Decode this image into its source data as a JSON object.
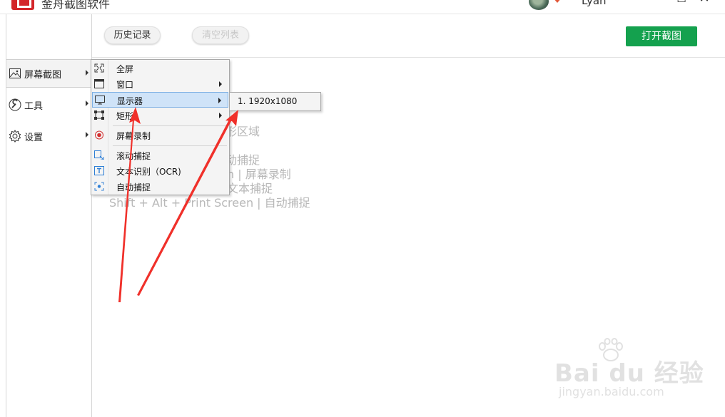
{
  "window": {
    "title": "金舟截图软件",
    "username": "Lyan",
    "minimize_glyph": "—",
    "maximize_glyph": "☐",
    "close_glyph": "✕"
  },
  "toolbar": {
    "history_label": "历史记录",
    "clear_label": "清空列表",
    "open_label": "打开截图"
  },
  "sidebar": {
    "items": [
      {
        "label": "屏幕截图",
        "icon": "image-icon",
        "active": true
      },
      {
        "label": "工具",
        "icon": "wrench-icon",
        "active": false
      },
      {
        "label": "设置",
        "icon": "gear-icon",
        "active": false
      }
    ]
  },
  "menu": {
    "items": [
      {
        "label": "全屏",
        "icon": "fullscreen-icon",
        "submenu": false
      },
      {
        "label": "窗口",
        "icon": "window-icon",
        "submenu": true
      },
      {
        "label": "显示器",
        "icon": "monitor-icon",
        "submenu": true,
        "highlighted": true
      },
      {
        "label": "矩形",
        "icon": "rectangle-icon",
        "submenu": true
      },
      {
        "label": "屏幕录制",
        "icon": "record-icon",
        "submenu": false
      },
      {
        "label": "滚动捕捉",
        "icon": "scroll-capture-icon",
        "submenu": false
      },
      {
        "label": "文本识别（OCR)",
        "icon": "ocr-text-icon",
        "submenu": false
      },
      {
        "label": "自动捕捉",
        "icon": "auto-capture-icon",
        "submenu": false
      }
    ]
  },
  "submenu": {
    "items": [
      {
        "label": "1. 1920x1080"
      }
    ]
  },
  "hints": [
    "形区域",
    "动捕捉",
    "n  |  屏幕录制",
    "文本捕捉",
    "Shift + Alt + Print Screen  |  自动捕捉"
  ],
  "watermark": {
    "brand": "Bai  du 经验",
    "url": "jingyan.baidu.com"
  },
  "colors": {
    "accent_green": "#14a14e",
    "logo_red": "#d3262a",
    "highlight_bg": "#cfe3f8",
    "annotation_red": "#f0302a"
  }
}
